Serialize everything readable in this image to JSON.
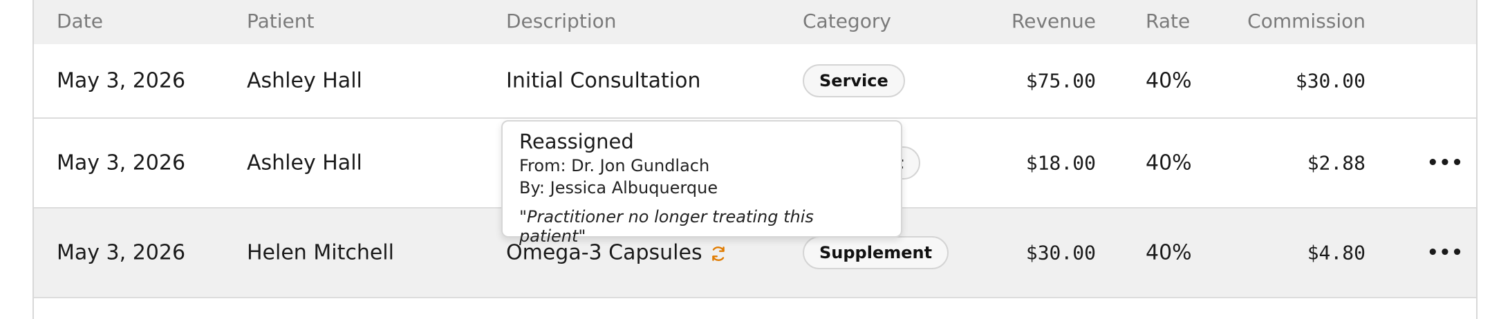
{
  "columns": {
    "date": "Date",
    "patient": "Patient",
    "description": "Description",
    "category": "Category",
    "revenue": "Revenue",
    "rate": "Rate",
    "commission": "Commission"
  },
  "rows": [
    {
      "date": "May 3, 2026",
      "patient": "Ashley Hall",
      "description": "Initial Consultation",
      "category": "Service",
      "revenue": "$75.00",
      "rate": "40%",
      "commission": "$30.00"
    },
    {
      "date": "May 3, 2026",
      "patient": "Ashley Hall",
      "description": "",
      "category_visible_fragment": "ent",
      "revenue": "$18.00",
      "rate": "40%",
      "commission": "$2.88",
      "menu": "•••"
    },
    {
      "date": "May 3, 2026",
      "patient": "Helen Mitchell",
      "description": "Omega-3 Capsules",
      "description_icon": "sync-icon",
      "category": "Supplement",
      "revenue": "$30.00",
      "rate": "40%",
      "commission": "$4.80",
      "menu": "•••"
    }
  ],
  "tooltip": {
    "title": "Reassigned",
    "from": "From: Dr. Jon Gundlach",
    "by": "By: Jessica Albuquerque",
    "reason": "\"Practitioner no longer treating this patient\""
  },
  "colors": {
    "header_bg": "#f0f0f0",
    "icon_accent": "#e07b00",
    "border": "#dcdcdc"
  }
}
